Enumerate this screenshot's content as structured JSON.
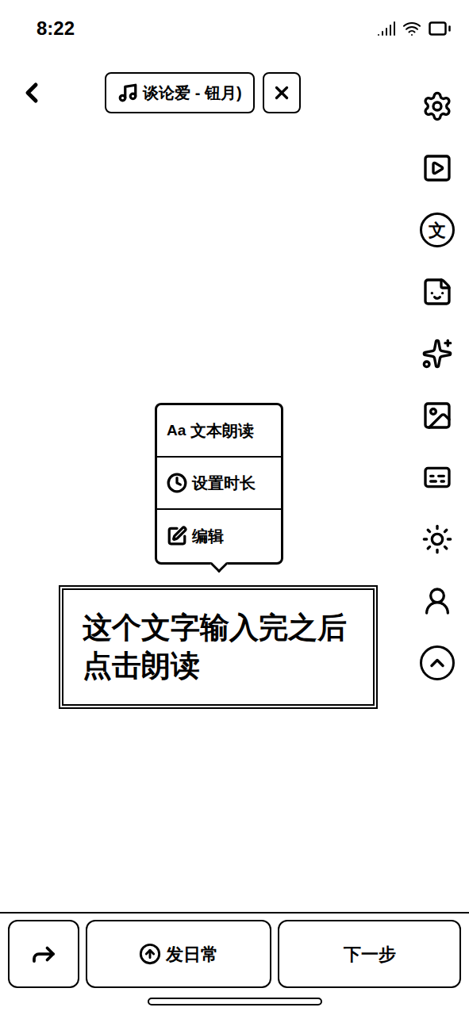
{
  "status_bar": {
    "time": "8:22"
  },
  "music": {
    "label": "谈论爱 - 钮月)"
  },
  "toolbar": {
    "text_icon": "文"
  },
  "context_menu": {
    "items": [
      {
        "icon_text": "Aa",
        "label": "文本朗读",
        "kind": "read"
      },
      {
        "icon_text": "",
        "label": "设置时长",
        "kind": "duration"
      },
      {
        "icon_text": "",
        "label": "编辑",
        "kind": "edit"
      }
    ]
  },
  "text_sticker": {
    "lines": [
      "这个文字输入完之后",
      "点击朗读"
    ]
  },
  "bottom_bar": {
    "daily_button": "发日常",
    "next_button": "下一步"
  }
}
